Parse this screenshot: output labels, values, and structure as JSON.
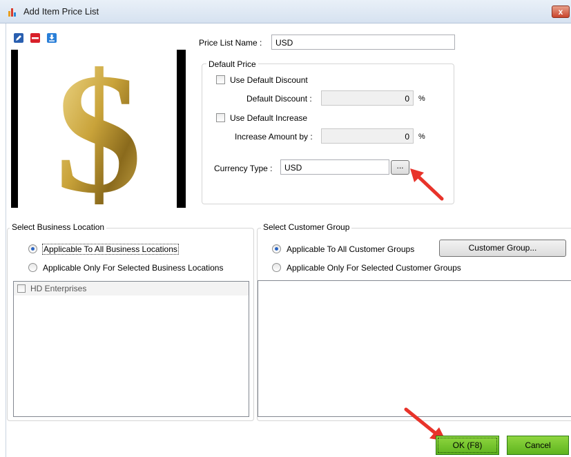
{
  "window": {
    "title": "Add Item Price List",
    "close_label": "x"
  },
  "toolbar": {
    "edit_icon": "pencil-icon",
    "remove_icon": "minus-icon",
    "download_icon": "download-icon"
  },
  "image": {
    "symbol": "$",
    "symbol_color": "#c9a33a"
  },
  "price_list_name": {
    "label": "Price List Name :",
    "value": "USD"
  },
  "default_price": {
    "title": "Default Price",
    "use_default_discount_label": "Use Default Discount",
    "use_default_discount_checked": false,
    "default_discount_label": "Default Discount :",
    "default_discount_value": "0",
    "default_discount_unit": "%",
    "use_default_increase_label": "Use Default Increase",
    "use_default_increase_checked": false,
    "increase_amount_label": "Increase Amount by :",
    "increase_amount_value": "0",
    "increase_amount_unit": "%",
    "currency_type_label": "Currency Type :",
    "currency_type_value": "USD",
    "browse_label": "..."
  },
  "business_location": {
    "title": "Select Business Location",
    "option_all": "Applicable To All Business Locations",
    "option_selected": "Applicable Only For Selected Business Locations",
    "selected_option": "all",
    "locations": [
      {
        "label": "HD Enterprises",
        "checked": false
      }
    ]
  },
  "customer_group": {
    "title": "Select Customer Group",
    "option_all": "Applicable To All Customer Groups",
    "option_selected": "Applicable Only For Selected Customer Groups",
    "selected_option": "all",
    "customer_group_button": "Customer Group..."
  },
  "footer": {
    "ok_label": "OK (F8)",
    "cancel_label": "Cancel"
  },
  "colors": {
    "accent_green": "#5fb41e",
    "arrow_red": "#e8332a",
    "titlebar": "#dbe6f3"
  }
}
